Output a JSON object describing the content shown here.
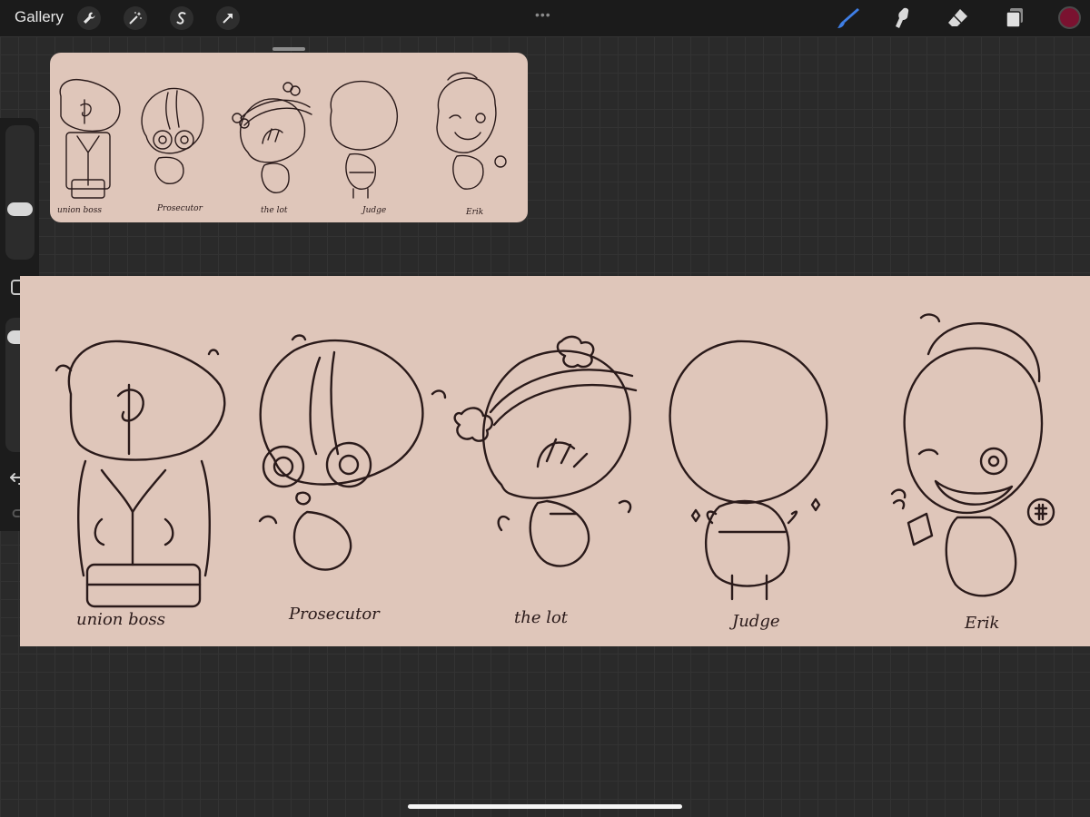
{
  "toolbar": {
    "gallery_label": "Gallery",
    "more_icon": "•••",
    "left_tools": [
      "wrench-icon",
      "magic-wand-icon",
      "selection-icon",
      "transform-arrow-icon"
    ],
    "right_tools": [
      "brush-icon",
      "smudge-icon",
      "eraser-icon",
      "layers-icon"
    ],
    "active_tool": "brush",
    "current_color": "#7a1230",
    "accent_color": "#3f7fe6"
  },
  "sidebar": {
    "brush_size": 0.18,
    "brush_opacity": 0.05,
    "controls": [
      "brush-size-slider",
      "modify-button",
      "brush-opacity-slider",
      "undo-icon",
      "redo-icon"
    ]
  },
  "canvas_background": "#dfc6ba",
  "characters": {
    "c1": "union boss",
    "c2": "Prosecutor",
    "c3": "the lot",
    "c4": "Judge",
    "c5": "Erik"
  }
}
